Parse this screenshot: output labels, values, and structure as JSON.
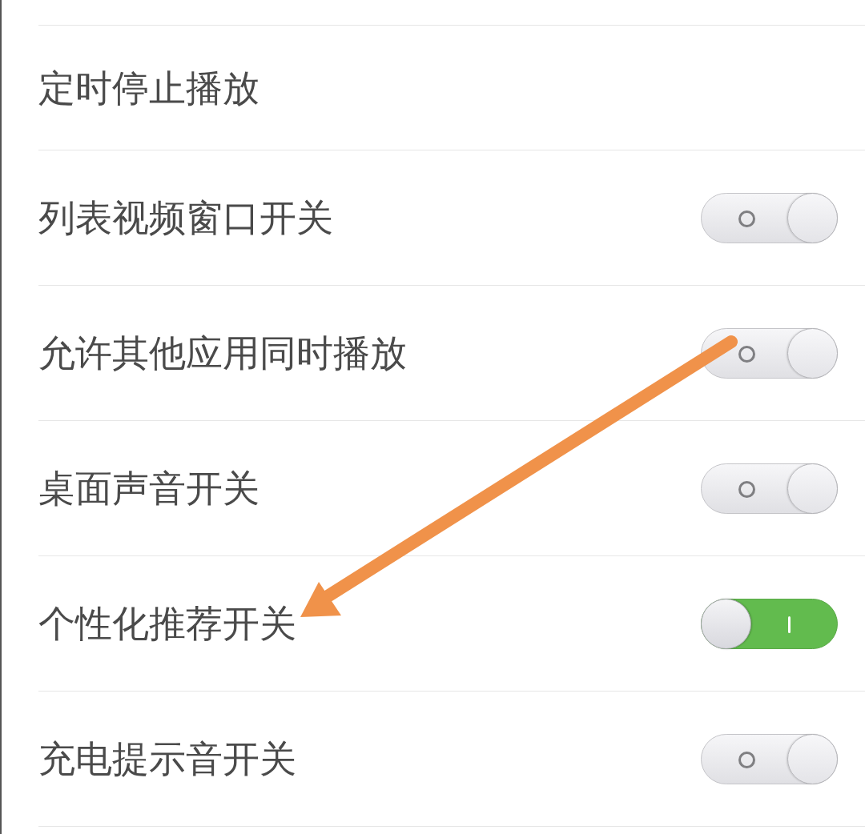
{
  "items": [
    {
      "kind": "link",
      "label": "定时停止播放"
    },
    {
      "kind": "toggle",
      "label": "列表视频窗口开关",
      "on": false
    },
    {
      "kind": "toggle",
      "label": "允许其他应用同时播放",
      "on": false
    },
    {
      "kind": "toggle",
      "label": "桌面声音开关",
      "on": false
    },
    {
      "kind": "toggle",
      "label": "个性化推荐开关",
      "on": true
    },
    {
      "kind": "toggle",
      "label": "充电提示音开关",
      "on": false
    }
  ]
}
